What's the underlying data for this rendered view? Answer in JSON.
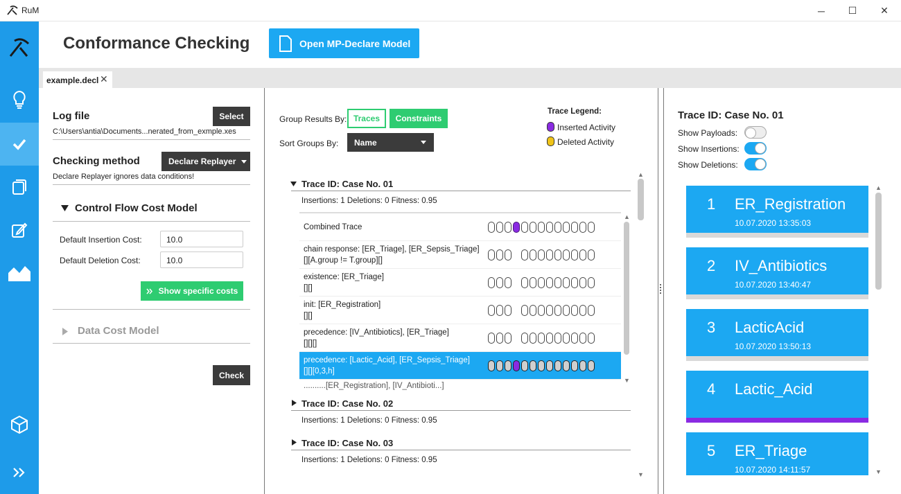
{
  "window": {
    "title": "RuM",
    "minimize": "─",
    "maximize": "☐",
    "close": "✕"
  },
  "header": {
    "title": "Conformance Checking",
    "open_model_label": "Open MP-Declare Model"
  },
  "tabs": [
    {
      "label": "example.decl",
      "close": "✕"
    }
  ],
  "left": {
    "log_file_heading": "Log file",
    "select_label": "Select",
    "log_path": "C:\\Users\\antia\\Documents...nerated_from_exmple.xes",
    "method_heading": "Checking method",
    "method_dropdown": "Declare Replayer",
    "method_note": "Declare Replayer ignores data conditions!",
    "cf_cost_heading": "Control Flow Cost Model",
    "insertion_label": "Default Insertion Cost:",
    "insertion_value": "10.0",
    "deletion_label": "Default Deletion Cost:",
    "deletion_value": "10.0",
    "show_costs_label": "Show specific costs",
    "data_cost_heading": "Data Cost Model",
    "check_label": "Check"
  },
  "middle": {
    "group_by_label": "Group Results By:",
    "group_traces": "Traces",
    "group_constraints": "Constraints",
    "sort_by_label": "Sort Groups By:",
    "sort_value": "Name",
    "legend_title": "Trace Legend:",
    "legend_inserted": "Inserted Activity",
    "legend_deleted": "Deleted Activity",
    "traces": [
      {
        "title": "Trace ID: Case No. 01",
        "stats": "Insertions: 1   Deletions: 0   Fitness: 0.95"
      },
      {
        "title": "Trace ID: Case No. 02",
        "stats": "Insertions: 1   Deletions: 0   Fitness: 0.95"
      },
      {
        "title": "Trace ID: Case No. 03",
        "stats": "Insertions: 1   Deletions: 0   Fitness: 0.95"
      }
    ],
    "rows": [
      {
        "line1": "Combined Trace",
        "line2": ""
      },
      {
        "line1": "chain response: [ER_Triage], [ER_Sepsis_Triage]",
        "line2": "[][A.group != T.group][]"
      },
      {
        "line1": "existence: [ER_Triage]",
        "line2": "[][]"
      },
      {
        "line1": "init: [ER_Registration]",
        "line2": "[][]"
      },
      {
        "line1": "precedence: [IV_Antibiotics], [ER_Triage]",
        "line2": "[][][]"
      },
      {
        "line1": "precedence: [Lactic_Acid], [ER_Sepsis_Triage]",
        "line2": "[][][0,3,h]"
      }
    ],
    "partial_row": "..........[ER_Registration], [IV_Antibioti...]"
  },
  "right": {
    "trace_title": "Trace ID: Case No. 01",
    "show_payloads": "Show Payloads:",
    "show_insertions": "Show Insertions:",
    "show_deletions": "Show Deletions:",
    "toggles": {
      "payloads": false,
      "insertions": true,
      "deletions": true
    },
    "events": [
      {
        "num": "1",
        "name": "ER_Registration",
        "time": "10.07.2020 13:35:03"
      },
      {
        "num": "2",
        "name": "IV_Antibiotics",
        "time": "10.07.2020 13:40:47"
      },
      {
        "num": "3",
        "name": "LacticAcid",
        "time": "10.07.2020 13:50:13"
      },
      {
        "num": "4",
        "name": "Lactic_Acid",
        "time": ""
      },
      {
        "num": "5",
        "name": "ER_Triage",
        "time": "10.07.2020 14:11:57"
      }
    ]
  },
  "colors": {
    "accent": "#1ca8f2",
    "sidebar": "#1e9be9",
    "green": "#2ecc71",
    "inserted": "#8a2be2",
    "deleted": "#f0c419"
  }
}
